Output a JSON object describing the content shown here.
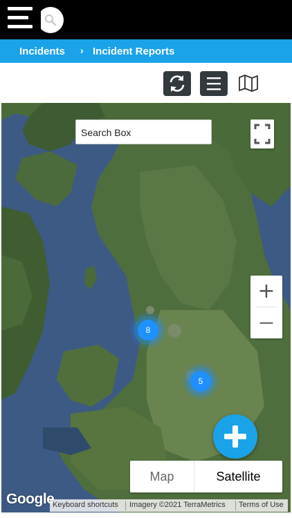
{
  "header": {
    "menu_icon": "hamburger-menu-icon",
    "logo_icon": "search-logo-icon"
  },
  "breadcrumb": {
    "items": [
      "Incidents",
      "Incident Reports"
    ],
    "separator": "›"
  },
  "toolbar": {
    "buttons": [
      "refresh-icon",
      "list-icon",
      "map-icon"
    ]
  },
  "map": {
    "search_placeholder": "Search Box",
    "clusters": [
      {
        "count": "8"
      },
      {
        "count": "5"
      }
    ],
    "zoom_in_label": "+",
    "zoom_out_label": "−",
    "map_type": {
      "options": [
        "Map",
        "Satellite"
      ],
      "selected": "Satellite"
    },
    "google_logo": "Google",
    "attribution": {
      "keyboard": "Keyboard shortcuts",
      "imagery": "Imagery ©2021 TerraMetrics",
      "terms": "Terms of Use"
    }
  },
  "colors": {
    "accent": "#1aa3e8",
    "topbar": "#000000",
    "cluster": "#1e90ff",
    "toolbar_button": "#333a3d"
  }
}
